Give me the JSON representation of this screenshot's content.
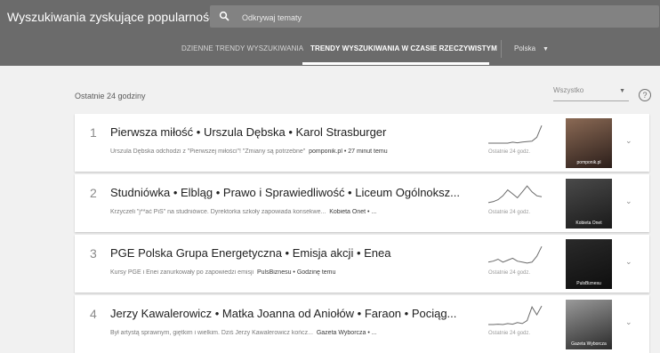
{
  "header": {
    "title": "Wyszukiwania zyskujące popularność",
    "search_placeholder": "Odkrywaj tematy"
  },
  "tabs": [
    {
      "label": "DZIENNE TRENDY WYSZUKIWANIA",
      "active": false
    },
    {
      "label": "TRENDY WYSZUKIWANIA W CZASIE RZECZYWISTYM",
      "active": true
    }
  ],
  "country": {
    "value": "Polska",
    "caret_icon": "triangle-down-icon"
  },
  "section": {
    "period_label": "Ostatnie 24 godziny",
    "filter_value": "Wszystko",
    "help_glyph": "?"
  },
  "colors": {
    "header_bg": "#6b6b6b",
    "page_bg": "#f1f1f1",
    "card_bg": "#ffffff"
  },
  "trends": [
    {
      "rank": "1",
      "title": "Pierwsza miłość • Urszula Dębska • Karol Strasburger",
      "snippet": "Urszula Dębska odchodzi z \"Pierwszej miłości\"! \"Zmiany są potrzebne\"",
      "meta": "pomponik.pl • 27 minut temu",
      "spark_label": "Ostatnie 24 godz.",
      "spark": [
        0,
        0,
        0,
        0,
        0,
        0.05,
        0.02,
        0.06,
        0.08,
        0.1,
        0.3,
        0.9
      ],
      "thumb_caption": "pomponik.pl"
    },
    {
      "rank": "2",
      "title": "Studniówka • Elbląg • Prawo i Sprawiedliwość • Liceum Ogólnoksz...",
      "snippet": "Krzyczeli \"j**ać PiS\" na studniówce. Dyrektorka szkoły zapowiada konsekwe...",
      "meta": "Kobieta Onet • ...",
      "spark_label": "Ostatnie 24 godz.",
      "spark": [
        0.05,
        0.1,
        0.2,
        0.4,
        0.7,
        0.5,
        0.3,
        0.6,
        0.9,
        0.6,
        0.4,
        0.35
      ],
      "thumb_caption": "Kobieta Onet"
    },
    {
      "rank": "3",
      "title": "PGE Polska Grupa Energetyczna • Emisja akcji • Enea",
      "snippet": "Kursy PGE i Enei zanurkowały po zapowiedzi emisji",
      "meta": "PulsBiznesu • Godzinę temu",
      "spark_label": "Ostatnie 24 godz.",
      "spark": [
        0.1,
        0.15,
        0.25,
        0.1,
        0.2,
        0.3,
        0.15,
        0.1,
        0.05,
        0.1,
        0.4,
        0.9
      ],
      "thumb_caption": "PulsBiznesu"
    },
    {
      "rank": "4",
      "title": "Jerzy Kawalerowicz • Matka Joanna od Aniołów • Faraon • Pociąg...",
      "snippet": "Był artystą sprawnym, giętkim i wielkim. Dziś Jerzy Kawalerowicz kończ...",
      "meta": "Gazeta Wyborcza • ...",
      "spark_label": "Ostatnie 24 godz.",
      "spark": [
        0,
        0,
        0.02,
        0,
        0.05,
        0.02,
        0.1,
        0.05,
        0.2,
        0.9,
        0.5,
        0.95
      ],
      "thumb_caption": "Gazeta Wyborcza"
    }
  ]
}
